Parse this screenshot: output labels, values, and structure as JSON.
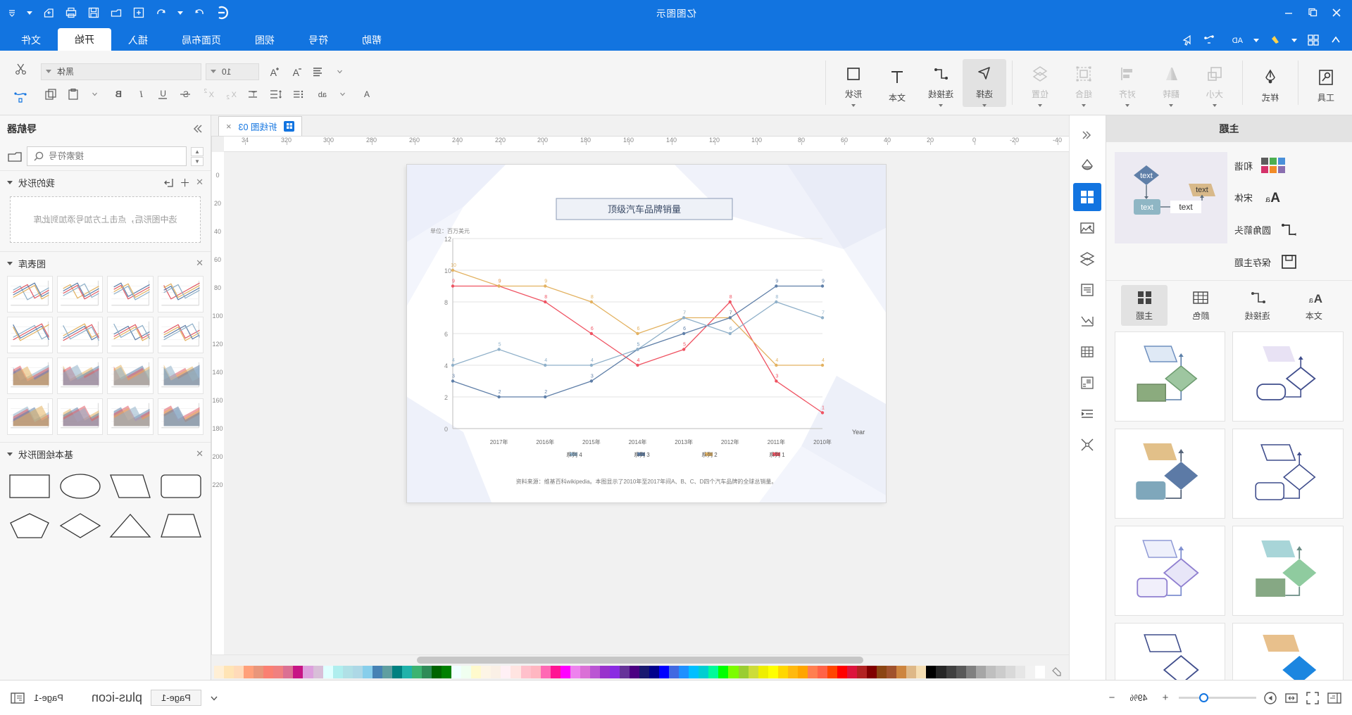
{
  "window": {
    "title": "亿图图示",
    "titlebar_left_icons": [
      "close-icon",
      "restore-icon",
      "minimize-icon"
    ],
    "titlebar_right_icons": [
      "account-icon",
      "redo-icon",
      "redo-dropdown-icon",
      "undo-icon",
      "new-icon",
      "open-icon",
      "save-icon",
      "print-icon",
      "export-icon",
      "quick-access-dropdown-icon"
    ]
  },
  "tabs": {
    "items": [
      {
        "label": "文件",
        "active": false
      },
      {
        "label": "开始",
        "active": true
      },
      {
        "label": "插入",
        "active": false
      },
      {
        "label": "页面布局",
        "active": false
      },
      {
        "label": "视图",
        "active": false
      },
      {
        "label": "符号",
        "active": false
      },
      {
        "label": "帮助",
        "active": false
      }
    ]
  },
  "quick_access": {
    "icons": [
      "pointer-icon",
      "cut-icon",
      "format-painter-icon",
      "ad-icon",
      "highlight-dropdown-icon",
      "highlight-icon",
      "grid-dropdown-icon",
      "grid-icon",
      "back-icon"
    ]
  },
  "ribbon": {
    "groups": [
      {
        "name": "工具",
        "icon": "tools-icon",
        "dimmed": false,
        "dropdown": true
      },
      {
        "name": "样式",
        "icon": "fill-bucket-icon",
        "dimmed": false,
        "dropdown": false
      },
      {
        "name": "大小",
        "icon": "size-icon",
        "dimmed": true,
        "dropdown": true
      },
      {
        "name": "翻转",
        "icon": "flip-icon",
        "dimmed": true,
        "dropdown": true
      },
      {
        "name": "对齐",
        "icon": "align-icon",
        "dimmed": true,
        "dropdown": true
      },
      {
        "name": "组合",
        "icon": "group-icon",
        "dimmed": true,
        "dropdown": true
      },
      {
        "name": "位置",
        "icon": "layers-icon",
        "dimmed": true,
        "dropdown": true
      },
      {
        "name": "选择",
        "icon": "cursor-arrow-icon",
        "dimmed": false,
        "dropdown": true,
        "active": true
      },
      {
        "name": "连接线",
        "icon": "connector-icon",
        "dimmed": false,
        "dropdown": true
      },
      {
        "name": "文本",
        "icon": "text-T-icon",
        "dimmed": false,
        "dropdown": false
      },
      {
        "name": "形状",
        "icon": "shape-square-icon",
        "dimmed": false,
        "dropdown": true
      }
    ],
    "font": {
      "family": "黑体",
      "size": "10"
    },
    "font_row1_icons": [
      "grow-font-icon",
      "shrink-font-icon",
      "align-text-icon",
      "align-dropdown-icon"
    ],
    "font_row2_icons": [
      "copy-icon",
      "paste-icon",
      "bold-icon",
      "italic-icon",
      "underline-icon",
      "strikethrough-icon",
      "superscript-icon",
      "subscript-icon",
      "text-indent-icon",
      "line-spacing-icon",
      "bullet-list-icon",
      "text-shadow-icon",
      "font-color-icon",
      "highlight-color-icon"
    ]
  },
  "left_panel": {
    "title": "主题",
    "options": [
      {
        "label": "和谐",
        "icon": "color-swatch-icon"
      },
      {
        "label": "宋体",
        "icon": "font-Aa-icon"
      },
      {
        "label": "圆角箭头",
        "icon": "connector-style-icon"
      },
      {
        "label": "保存主题",
        "icon": "save-floppy-icon"
      }
    ],
    "tabs": [
      {
        "label": "主题",
        "icon": "theme-grid-icon",
        "active": true
      },
      {
        "label": "颜色",
        "icon": "color-table-icon",
        "active": false
      },
      {
        "label": "连接线",
        "icon": "connector-icon",
        "active": false
      },
      {
        "label": "文本",
        "icon": "font-Aa-icon",
        "active": false
      }
    ],
    "theme_cards_count": 6
  },
  "rail": {
    "items": [
      {
        "name": "fill-style-icon",
        "active": false
      },
      {
        "name": "shapes-grid-icon",
        "active": true
      },
      {
        "name": "image-icon",
        "active": false
      },
      {
        "name": "layers-icon",
        "active": false
      },
      {
        "name": "notes-icon",
        "active": false
      },
      {
        "name": "chart-icon",
        "active": false
      },
      {
        "name": "table-icon",
        "active": false
      },
      {
        "name": "container-icon",
        "active": false
      },
      {
        "name": "callout-icon",
        "active": false
      },
      {
        "name": "merge-icon",
        "active": false
      }
    ],
    "collapse_icon": "collapse-left-icon"
  },
  "document_tab": {
    "label": "折线图 03",
    "close": "×"
  },
  "ruler": {
    "h_ticks": [
      "-40",
      "-20",
      "0",
      "20",
      "40",
      "60",
      "80",
      "100",
      "120",
      "140",
      "160",
      "180",
      "200",
      "220",
      "240",
      "260",
      "280",
      "300",
      "320",
      "34"
    ],
    "v_ticks": [
      "0",
      "20",
      "40",
      "60",
      "80",
      "100",
      "120",
      "140",
      "160",
      "180",
      "200",
      "220"
    ]
  },
  "chart_data": {
    "type": "line",
    "title": "顶级汽车品牌销量",
    "xlabel": "Year",
    "ylabel": "单位：百万美元",
    "source_note": "资料来源：维基百科wikipedia。本图显示了2010年至2017年间A、B、C、D四个汽车品牌的全球总销量。",
    "categories": [
      "2010年",
      "2011年",
      "2012年",
      "2013年",
      "2014年",
      "2015年",
      "2016年",
      "2017年"
    ],
    "ylim": [
      0,
      12
    ],
    "yticks": [
      "0",
      "2",
      "4",
      "6",
      "8",
      "10",
      "12"
    ],
    "grid": true,
    "legend_position": "bottom",
    "series": [
      {
        "name": "系列 1",
        "color": "#ef5362",
        "values": [
          1.0,
          3.0,
          8.0,
          5.0,
          4.0,
          6.0,
          8.0,
          9.0,
          9.0
        ]
      },
      {
        "name": "系列 2",
        "color": "#e3b261",
        "values": [
          4.0,
          4.0,
          7.0,
          7.0,
          6.0,
          8.0,
          9.0,
          9.0,
          10.0
        ]
      },
      {
        "name": "系列 3",
        "color": "#5f7fa8",
        "values": [
          9.0,
          9.0,
          7.0,
          6.0,
          5.0,
          3.0,
          2.0,
          2.0,
          3.0
        ]
      },
      {
        "name": "系列 4",
        "color": "#8fb0c9",
        "values": [
          7.0,
          8.0,
          6.0,
          7.0,
          5.0,
          4.0,
          4.0,
          5.0,
          4.0
        ]
      }
    ]
  },
  "right_panel": {
    "title": "导航器",
    "collapse_icon": "collapse-right-icon",
    "search": {
      "placeholder": "搜索符号",
      "value": "",
      "icon": "search-icon",
      "library_icon": "library-icon"
    },
    "sections": [
      {
        "title": "我的形状",
        "icons": [
          "import-icon",
          "plus-icon",
          "close-icon"
        ],
        "empty_text": "选中图形后，点击上方加号添加到此库"
      },
      {
        "title": "图表库",
        "icons": [
          "close-icon"
        ],
        "charts_count": 16
      },
      {
        "title": "基本绘图形状",
        "icons": [
          "close-icon"
        ],
        "shapes_count": 8
      }
    ]
  },
  "status_bar": {
    "page_label": "Page-1",
    "page_tab": "Page-1",
    "add_page_icon": "plus-icon",
    "page_dropdown_icon": "chevron-down-icon",
    "zoom_value": "49%",
    "zoom_in": "+",
    "zoom_out": "−",
    "icons": [
      "fit-page-icon",
      "fullscreen-icon",
      "presentation-icon",
      "page-list-icon"
    ]
  },
  "colors": {
    "accent": "#1274e0",
    "ribbon_bg": "#f5f5f5",
    "panel_bg": "#f7f7f7",
    "canvas_bg": "#f1f1f1"
  }
}
